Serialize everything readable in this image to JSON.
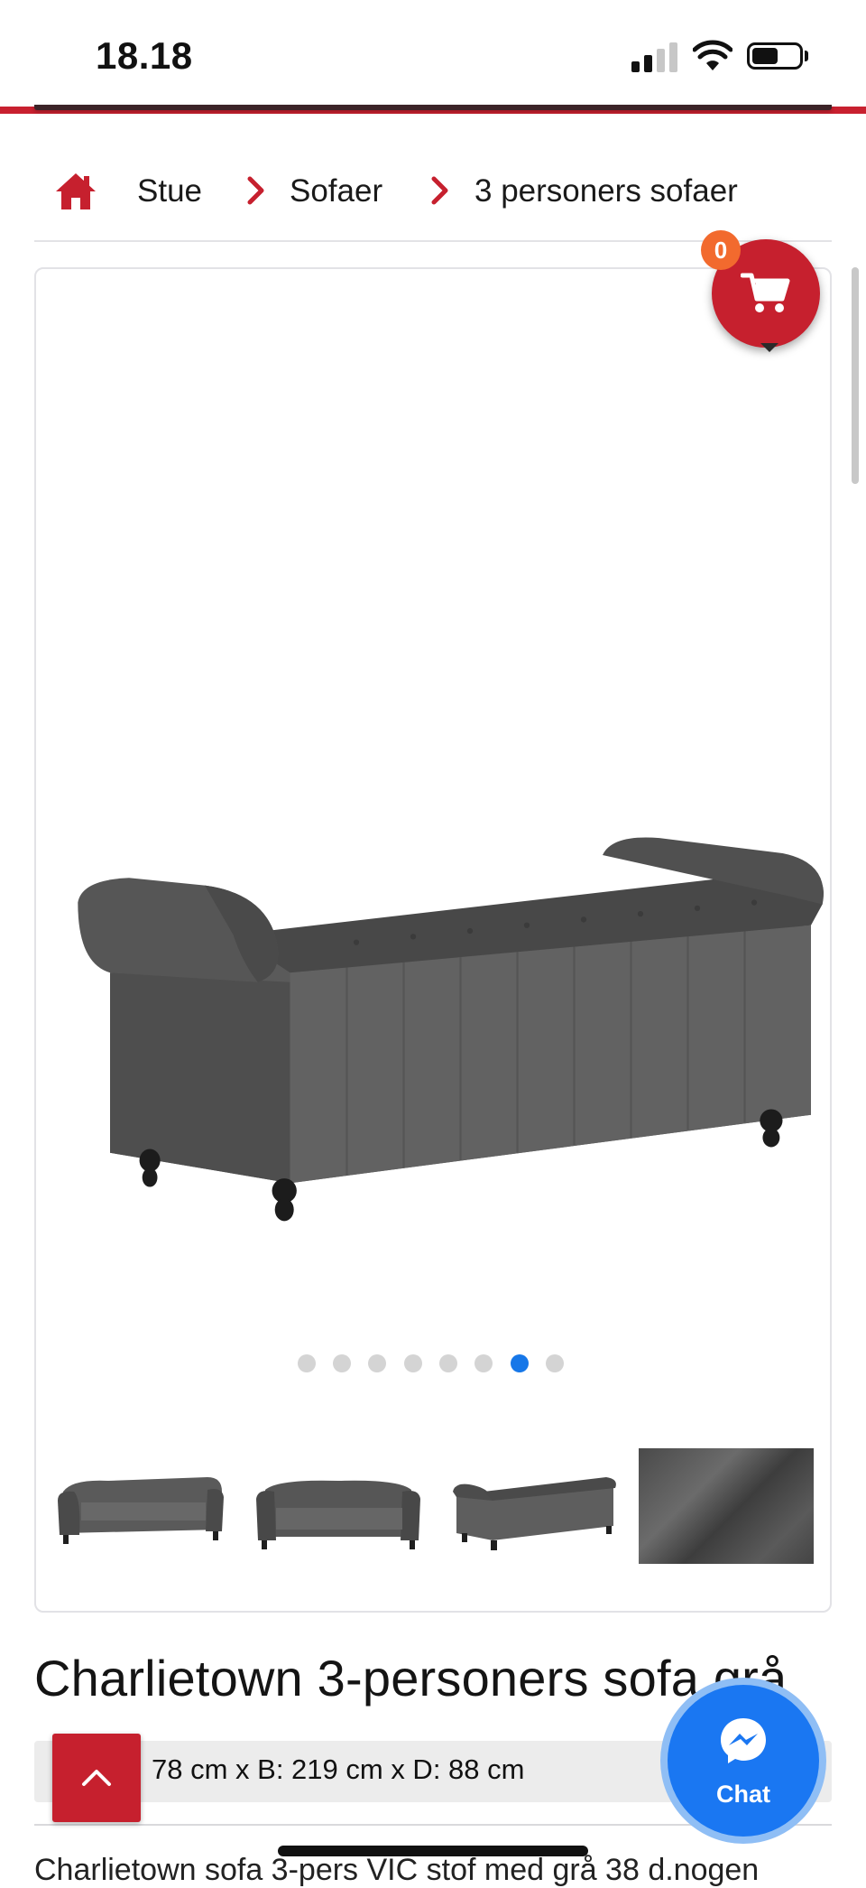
{
  "status_bar": {
    "time": "18.18",
    "icons": [
      "signal-icon",
      "wifi-icon",
      "battery-icon"
    ]
  },
  "breadcrumb": {
    "home_icon": "home-icon",
    "items": [
      {
        "label": "Stue"
      },
      {
        "label": "Sofaer"
      },
      {
        "label": "3 personers sofaer"
      }
    ]
  },
  "cart": {
    "count": "0",
    "icon": "shopping-cart-icon"
  },
  "gallery": {
    "image_count": 8,
    "active_index": 6,
    "thumbnails": [
      "sofa-front-angle",
      "sofa-front",
      "sofa-back",
      "fabric-closeup"
    ]
  },
  "product": {
    "title": "Charlietown 3-personers sofa grå",
    "dimensions": "78 cm x B: 219 cm x D: 88 cm",
    "description_start": "Charlietown sofa 3-pers VIC stof med grå 38 d.nogen"
  },
  "chat": {
    "label": "Chat",
    "icon": "messenger-icon"
  },
  "back_to_top_icon": "chevron-up-icon",
  "colors": {
    "brand_red": "#c6202e",
    "accent_blue": "#1677e8",
    "badge_orange": "#f26a2e",
    "messenger_blue": "#1a77f2"
  }
}
